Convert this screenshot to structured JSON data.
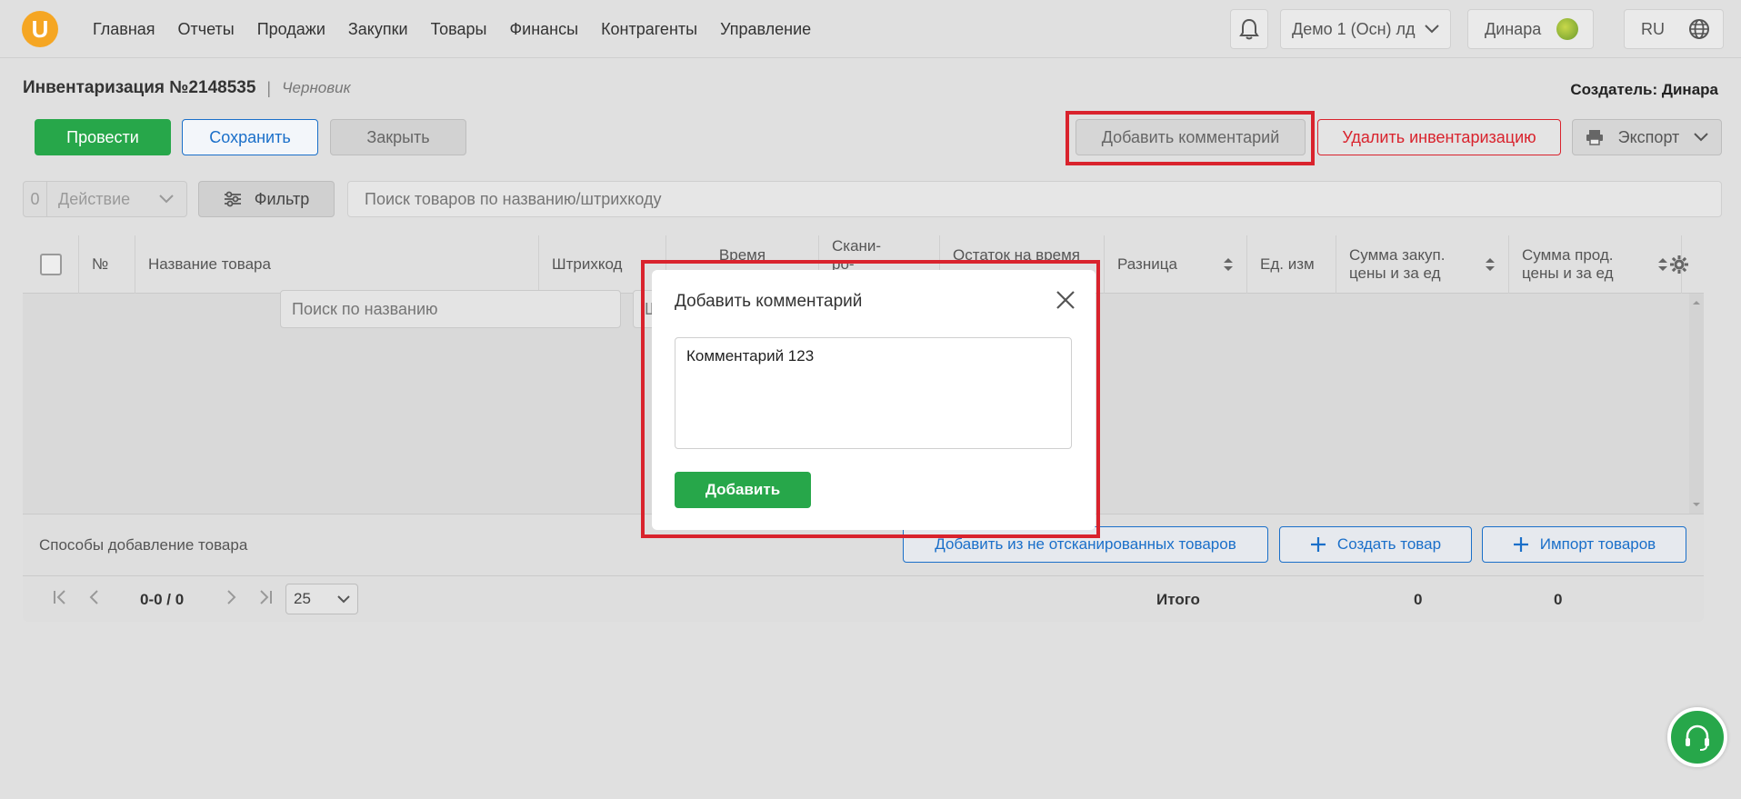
{
  "logo": {
    "letter": "U"
  },
  "nav": [
    "Главная",
    "Отчеты",
    "Продажи",
    "Закупки",
    "Товары",
    "Финансы",
    "Контрагенты",
    "Управление"
  ],
  "topbar": {
    "company": "Демо 1 (Осн) лд",
    "user": "Динара",
    "lang": "RU"
  },
  "header": {
    "title": "Инвентаризация №2148535",
    "separator": "|",
    "status": "Черновик",
    "creator": "Создатель: Динара"
  },
  "actions": {
    "conduct": "Провести",
    "save": "Сохранить",
    "close": "Закрыть",
    "add_comment": "Добавить комментарий",
    "delete": "Удалить инвентаризацию",
    "export": "Экспорт"
  },
  "toolbar": {
    "action_count": "0",
    "action_label": "Действие",
    "filter_label": "Фильтр",
    "search_placeholder": "Поиск товаров по названию/штрихкоду"
  },
  "table": {
    "columns": [
      "№",
      "Название товара",
      "Штрихкод",
      "Время",
      "Скани-\nро-",
      "Остаток на время",
      "Разница",
      "Ед. изм",
      "Сумма закуп.\nцены и за ед",
      "Сумма прод.\nцены и за ед"
    ]
  },
  "add_methods": {
    "label": "Способы добавление товара",
    "name_placeholder": "Поиск по названию",
    "barcode_placeholder": "Штрихкод",
    "add_unscanned": "Добавить из не отсканированных товаров",
    "create_product": "Создать товар",
    "import_products": "Импорт товаров"
  },
  "pagination": {
    "range": "0-0 / 0",
    "page_size": "25",
    "total_label": "Итого",
    "total_purchase": "0",
    "total_sale": "0"
  },
  "modal": {
    "title": "Добавить комментарий",
    "comment_value": "Комментарий 123",
    "submit": "Добавить"
  }
}
